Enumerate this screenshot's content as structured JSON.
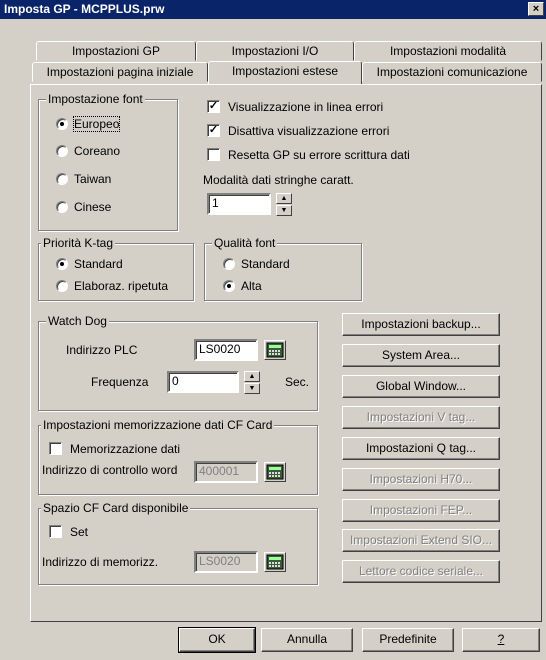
{
  "window": {
    "title": "Imposta GP - MCPPLUS.prw",
    "close": "×"
  },
  "tabs_row1": [
    "Impostazioni GP",
    "Impostazioni I/O",
    "Impostazioni modalità"
  ],
  "tabs_row2": [
    "Impostazioni pagina iniziale",
    "Impostazioni estese",
    "Impostazioni comunicazione"
  ],
  "active_tab": "Impostazioni estese",
  "font_group": {
    "title": "Impostazione font",
    "options": [
      "Europeo",
      "Coreano",
      "Taiwan",
      "Cinese"
    ],
    "selected": "Europeo"
  },
  "checks": [
    {
      "label": "Visualizzazione in linea errori",
      "checked": true
    },
    {
      "label": "Disattiva visualizzazione errori",
      "checked": true
    },
    {
      "label": "Resetta GP su errore scrittura dati",
      "checked": false
    }
  ],
  "string_mode": {
    "label": "Modalità dati stringhe caratt.",
    "value": "1"
  },
  "ktag_group": {
    "title": "Priorità K-tag",
    "options": [
      "Standard",
      "Elaboraz. ripetuta"
    ],
    "selected": "Standard"
  },
  "quality_group": {
    "title": "Qualità font",
    "options": [
      "Standard",
      "Alta"
    ],
    "selected": "Alta"
  },
  "watchdog": {
    "title": "Watch Dog",
    "addr_label": "Indirizzo PLC",
    "addr_value": "LS0020",
    "freq_label": "Frequenza",
    "freq_value": "0",
    "freq_unit": "Sec."
  },
  "cf_store": {
    "title": "Impostazioni memorizzazione dati CF Card",
    "check_label": "Memorizzazione dati",
    "checked": false,
    "addr_label": "Indirizzo di controllo word",
    "addr_value": "400001"
  },
  "cf_space": {
    "title": "Spazio CF Card disponibile",
    "check_label": "Set",
    "checked": false,
    "addr_label": "Indirizzo di memorizz.",
    "addr_value": "LS0020"
  },
  "side_buttons": [
    {
      "label": "Impostazioni backup...",
      "enabled": true
    },
    {
      "label": "System Area...",
      "enabled": true
    },
    {
      "label": "Global Window...",
      "enabled": true
    },
    {
      "label": "Impostazioni V tag...",
      "enabled": false
    },
    {
      "label": "Impostazioni Q tag...",
      "enabled": true
    },
    {
      "label": "Impostazioni H70...",
      "enabled": false
    },
    {
      "label": "Impostazioni FEP...",
      "enabled": false
    },
    {
      "label": "Impostazioni Extend SIO...",
      "enabled": false
    },
    {
      "label": "Lettore codice seriale...",
      "enabled": false
    }
  ],
  "footer": {
    "ok": "OK",
    "cancel": "Annulla",
    "defaults": "Predefinite",
    "help": "?"
  }
}
